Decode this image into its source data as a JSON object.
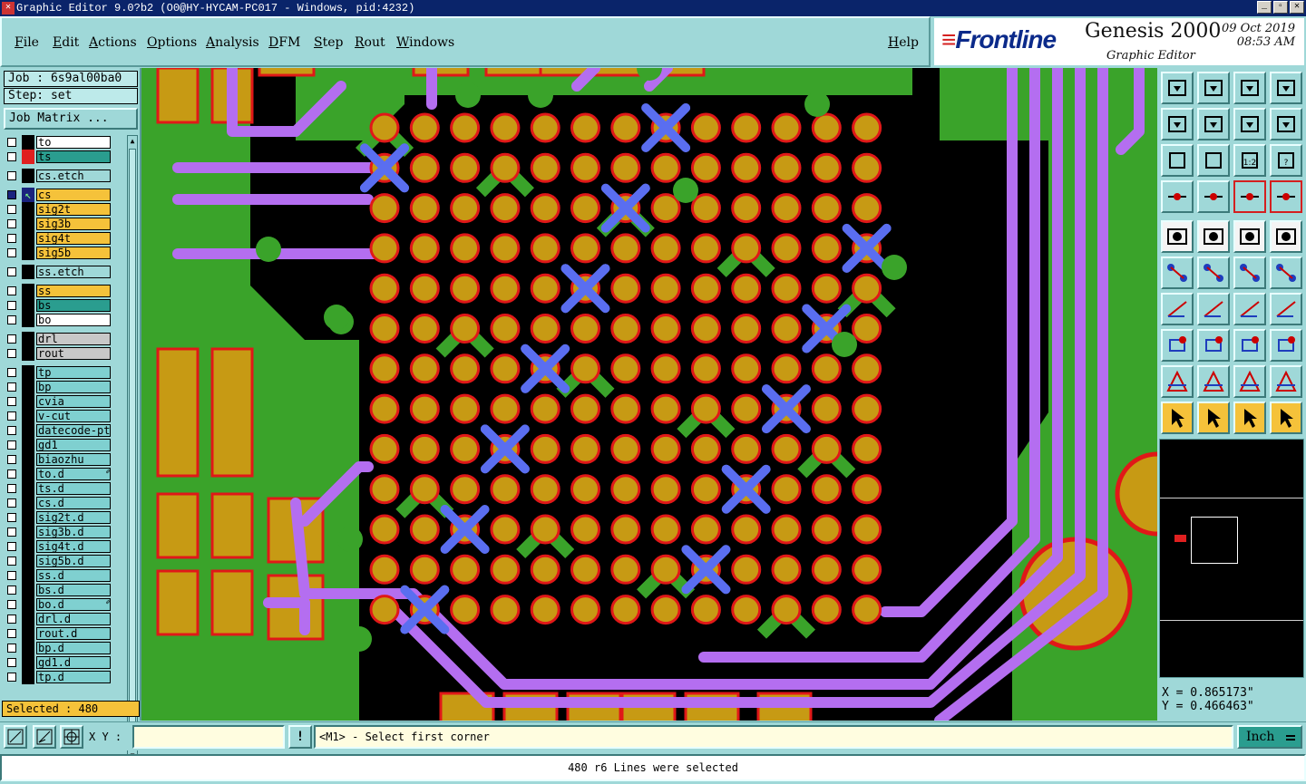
{
  "window": {
    "title": "Graphic Editor 9.0?b2 (O0@HY-HYCAM-PC017 - Windows, pid:4232)"
  },
  "menu": [
    "File",
    "Edit",
    "Actions",
    "Options",
    "Analysis",
    "DFM",
    "Step",
    "Rout",
    "Windows"
  ],
  "help_label": "Help",
  "brand": {
    "logo": "Frontline",
    "product": "Genesis 2000",
    "subtitle": "Graphic Editor",
    "date": "09 Oct 2019",
    "time": "08:53 AM"
  },
  "job": {
    "job_line": "Job : 6s9al00ba0",
    "step_line": "Step: set",
    "matrix_button": "Job Matrix ..."
  },
  "layers": [
    {
      "name": "to",
      "type": "white",
      "ind": "#000000"
    },
    {
      "name": "ts",
      "type": "sm",
      "ind": "#e02020"
    },
    {
      "name": "cs.etch",
      "type": "board",
      "ind": "#000000",
      "gap": true
    },
    {
      "name": "cs",
      "type": "sel",
      "ind": "#1a237e",
      "active": true,
      "gap": true
    },
    {
      "name": "sig2t",
      "type": "signal",
      "ind": "#000000"
    },
    {
      "name": "sig3b",
      "type": "signal",
      "ind": "#000000"
    },
    {
      "name": "sig4t",
      "type": "signal",
      "ind": "#000000"
    },
    {
      "name": "sig5b",
      "type": "signal",
      "ind": "#000000"
    },
    {
      "name": "ss.etch",
      "type": "board",
      "ind": "#000000",
      "gap": true
    },
    {
      "name": "ss",
      "type": "signal",
      "ind": "#000000",
      "gap": true
    },
    {
      "name": "bs",
      "type": "sm",
      "ind": "#000000"
    },
    {
      "name": "bo",
      "type": "white",
      "ind": "#000000"
    },
    {
      "name": "drl",
      "type": "grey",
      "ind": "#000000",
      "gap": true
    },
    {
      "name": "rout",
      "type": "grey",
      "ind": "#000000"
    },
    {
      "name": "tp",
      "type": "teal",
      "ind": "#000000",
      "gap": true
    },
    {
      "name": "bp",
      "type": "teal",
      "ind": "#000000"
    },
    {
      "name": "cvia",
      "type": "teal",
      "ind": "#000000"
    },
    {
      "name": "v-cut",
      "type": "teal",
      "ind": "#000000"
    },
    {
      "name": "datecode-pte",
      "type": "teal",
      "ind": "#000000"
    },
    {
      "name": "gd1",
      "type": "teal",
      "ind": "#000000"
    },
    {
      "name": "biaozhu",
      "type": "teal",
      "ind": "#000000"
    },
    {
      "name": "to.d",
      "type": "teal",
      "ind": "#000000",
      "mark": "✐"
    },
    {
      "name": "ts.d",
      "type": "teal",
      "ind": "#000000"
    },
    {
      "name": "cs.d",
      "type": "teal",
      "ind": "#000000"
    },
    {
      "name": "sig2t.d",
      "type": "teal",
      "ind": "#000000"
    },
    {
      "name": "sig3b.d",
      "type": "teal",
      "ind": "#000000"
    },
    {
      "name": "sig4t.d",
      "type": "teal",
      "ind": "#000000"
    },
    {
      "name": "sig5b.d",
      "type": "teal",
      "ind": "#000000"
    },
    {
      "name": "ss.d",
      "type": "teal",
      "ind": "#000000"
    },
    {
      "name": "bs.d",
      "type": "teal",
      "ind": "#000000"
    },
    {
      "name": "bo.d",
      "type": "teal",
      "ind": "#000000",
      "mark": "✐"
    },
    {
      "name": "drl.d",
      "type": "teal",
      "ind": "#000000"
    },
    {
      "name": "rout.d",
      "type": "teal",
      "ind": "#000000"
    },
    {
      "name": "bp.d",
      "type": "teal",
      "ind": "#000000"
    },
    {
      "name": "gd1.d",
      "type": "teal",
      "ind": "#000000"
    },
    {
      "name": "tp.d",
      "type": "teal",
      "ind": "#000000"
    }
  ],
  "selected": "Selected : 480",
  "tools": [
    "zoom-home-icon",
    "zoom-fit-icon",
    "home-icon",
    "window-icon",
    "pan-left-icon",
    "pan-right-icon",
    "step-icon",
    "redraw-icon",
    "fit-all-icon",
    "center-icon",
    "scale-1-2-icon",
    "query-icon",
    "measure-icon",
    "snap-icon",
    "layer-display-icon",
    "layer-display-all-icon",
    "record-icon",
    "sketch-icon",
    "ruler-icon",
    "pad-icon",
    "connect-icon",
    "cross-icon",
    "line-add-icon",
    "line-direction-icon",
    "angle-icon",
    "slash-icon",
    "arc-icon",
    "feature-icon",
    "move-icon",
    "line-cut-icon",
    "resize-icon",
    "polygon-icon",
    "triangle-icon",
    "triangle-a-icon",
    "triangle-b-icon",
    "triangle-c-icon",
    "select-icon",
    "select-box-icon",
    "select-box2-icon",
    "select-net-icon"
  ],
  "coords": {
    "x_line": "X = 0.865173\"",
    "y_line": "Y = 0.466463\""
  },
  "command": {
    "xy_label": "X Y :",
    "xy_value": "",
    "prompt": "<M1> - Select first corner",
    "units": "Inch"
  },
  "status": "480 r6 Lines were selected",
  "colors": {
    "copper": "#3aa32a",
    "pad": "#c79a14",
    "mask": "#e01818",
    "trace": "#b46ef0",
    "selected_trace": "#5a6ef0",
    "background": "#000000"
  }
}
